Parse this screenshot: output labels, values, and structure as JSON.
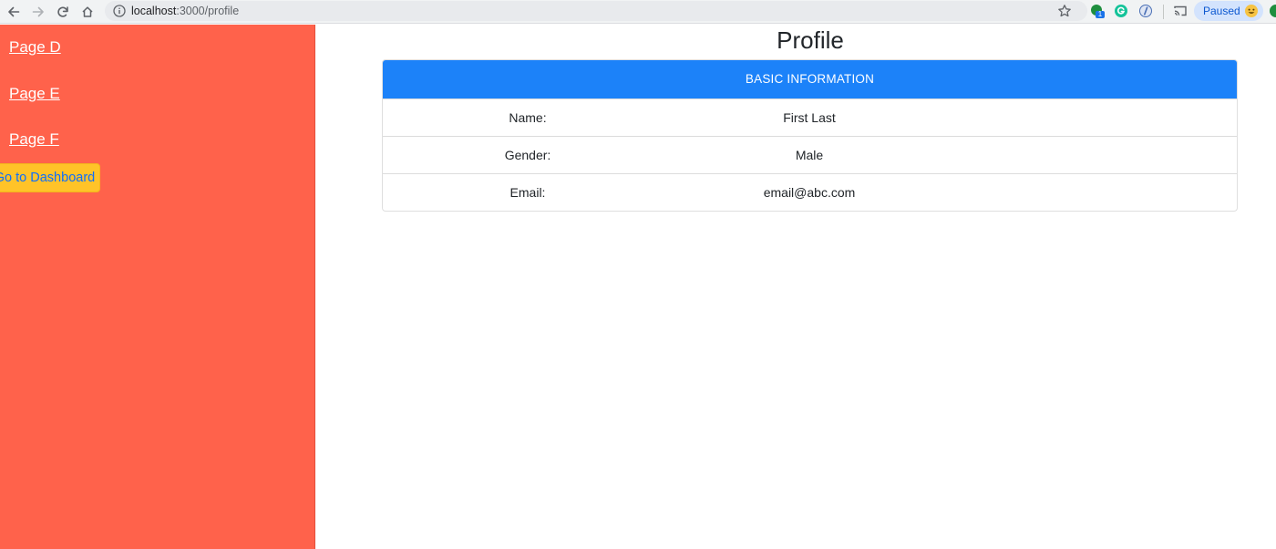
{
  "browser": {
    "url_host": "localhost",
    "url_path": ":3000/profile",
    "extension_badge": "1",
    "profile_status": "Paused"
  },
  "sidebar": {
    "links": [
      {
        "label": "Page D"
      },
      {
        "label": "Page E"
      },
      {
        "label": "Page F"
      }
    ],
    "dashboard_button_label": "Go to Dashboard"
  },
  "main": {
    "title": "Profile",
    "card": {
      "header": "BASIC INFORMATION",
      "rows": [
        {
          "label": "Name:",
          "value": "First Last"
        },
        {
          "label": "Gender:",
          "value": "Male"
        },
        {
          "label": "Email:",
          "value": "email@abc.com"
        }
      ]
    }
  },
  "colors": {
    "sidebar_bg": "#ff624b",
    "card_header_bg": "#1c82f9",
    "dashboard_button_bg": "#ffc328",
    "dashboard_button_text": "#0d6efd"
  },
  "icons": {
    "back": "arrow-left-icon",
    "forward": "arrow-right-icon",
    "reload": "reload-icon",
    "home": "home-icon",
    "site_info": "info-icon",
    "bookmark": "star-icon",
    "cast": "cast-icon"
  }
}
